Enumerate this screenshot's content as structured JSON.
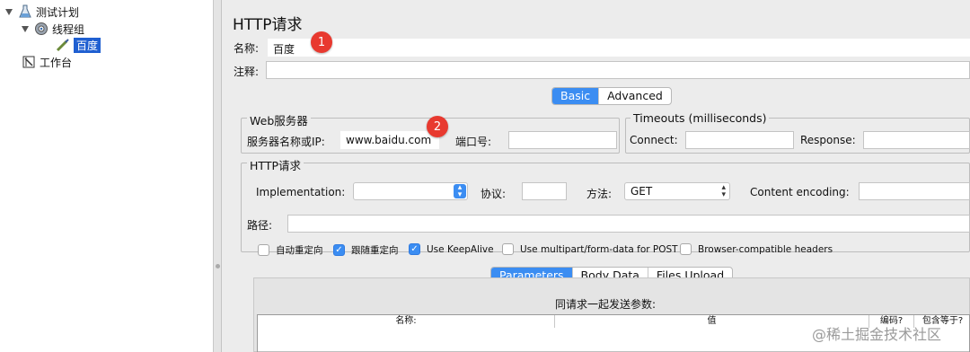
{
  "tree": {
    "items": [
      {
        "label": "测试计划",
        "icon": "test-plan-icon"
      },
      {
        "label": "线程组",
        "icon": "gear-icon"
      },
      {
        "label": "百度",
        "icon": "sampler-icon",
        "selected": true
      },
      {
        "label": "工作台",
        "icon": "workbench-icon"
      }
    ]
  },
  "panel": {
    "title": "HTTP请求",
    "name_label": "名称:",
    "name_value": "百度",
    "comment_label": "注释:",
    "comment_value": "",
    "badge1": "1",
    "badge2": "2"
  },
  "tabs_top": {
    "basic": "Basic",
    "advanced": "Advanced"
  },
  "web_server": {
    "title": "Web服务器",
    "server_label": "服务器名称或IP:",
    "server_value": "www.baidu.com",
    "port_label": "端口号:",
    "port_value": ""
  },
  "timeouts": {
    "title": "Timeouts (milliseconds)",
    "connect_label": "Connect:",
    "connect_value": "",
    "response_label": "Response:",
    "response_value": ""
  },
  "http_request": {
    "title": "HTTP请求",
    "implementation_label": "Implementation:",
    "implementation_value": "",
    "protocol_label": "协议:",
    "protocol_value": "",
    "method_label": "方法:",
    "method_value": "GET",
    "encoding_label": "Content encoding:",
    "encoding_value": "",
    "path_label": "路径:",
    "path_value": ""
  },
  "checkboxes": [
    {
      "label": "自动重定向",
      "checked": false
    },
    {
      "label": "跟随重定向",
      "checked": true
    },
    {
      "label": "Use KeepAlive",
      "checked": true
    },
    {
      "label": "Use multipart/form-data for POST",
      "checked": false
    },
    {
      "label": "Browser-compatible headers",
      "checked": false
    }
  ],
  "tabs_params": {
    "parameters": "Parameters",
    "body_data": "Body Data",
    "files_upload": "Files Upload"
  },
  "params_table": {
    "caption": "同请求一起发送参数:",
    "columns": [
      "名称:",
      "值",
      "编码?",
      "包含等于?"
    ]
  },
  "watermark": "@稀土掘金技术社区",
  "colors": {
    "accent": "#3b8df2",
    "badge": "#e8392f",
    "selection": "#1f5fd1"
  }
}
